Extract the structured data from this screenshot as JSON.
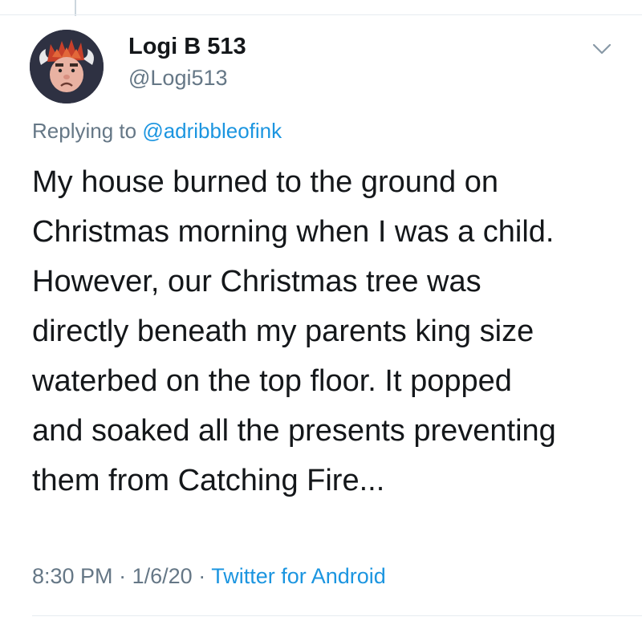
{
  "tweet": {
    "author": {
      "display_name": "Logi B 513",
      "handle": "@Logi513",
      "avatar_icon": "cartoon-face-avatar"
    },
    "replying_to": {
      "prefix": "Replying to",
      "mention": "@adribbleofink"
    },
    "text_lines": [
      "My house burned to the ground on",
      "Christmas morning when I was a child.",
      "However, our Christmas tree was",
      "directly beneath my parents king size",
      "waterbed on the top floor. It popped",
      "and soaked all the presents preventing",
      "them from Catching Fire..."
    ],
    "time": "8:30 PM",
    "date": "1/6/20",
    "separator": "·",
    "source": "Twitter for Android",
    "menu_icon": "chevron-down-icon"
  },
  "colors": {
    "text_primary": "#14171a",
    "text_secondary": "#657786",
    "link": "#1b95e0",
    "border": "#e6ecf0"
  }
}
